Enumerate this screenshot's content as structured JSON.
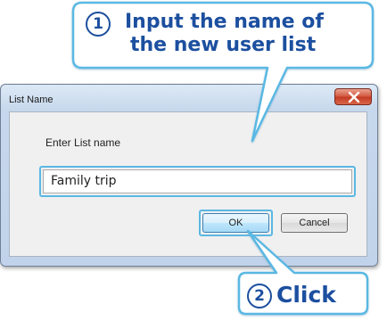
{
  "dialog": {
    "title": "List Name",
    "prompt_label": "Enter List name",
    "input_value": "Family trip",
    "ok_label": "OK",
    "cancel_label": "Cancel"
  },
  "callouts": {
    "step1_number": "1",
    "step1_line1": "Input the name of",
    "step1_line2": "the new user list",
    "step2_number": "2",
    "step2_text": "Click"
  },
  "colors": {
    "callout_text": "#1c4f9f",
    "callout_border": "#5ab8e3",
    "close_button": "#c23a22"
  },
  "icons": {
    "close": "close-x-icon"
  }
}
